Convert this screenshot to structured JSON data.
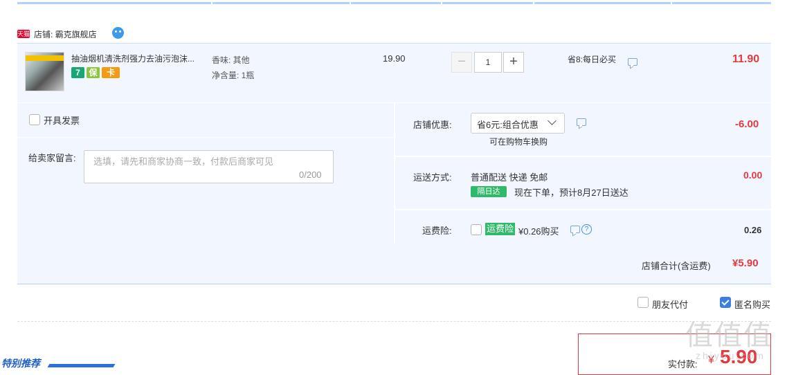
{
  "shop": {
    "badge": "天猫",
    "label": "店铺: 霸克旗舰店"
  },
  "item": {
    "title": "抽油烟机清洗剂强力去油污泡沫...",
    "attr_scent": "香味: 其他",
    "attr_volume": "净含量: 1瓶",
    "unit_price": "19.90",
    "quantity": "1",
    "qty_minus": "−",
    "qty_plus": "+",
    "promo": "省8:每日必买",
    "subtotal": "11.90",
    "service_icons": [
      "7",
      "保",
      "卡"
    ]
  },
  "invoice": {
    "label": "开具发票"
  },
  "message": {
    "label": "给卖家留言:",
    "placeholder": "选填，请先和商家协商一致，付款后商家可见",
    "count": "0/200"
  },
  "discount": {
    "label": "店铺优惠:",
    "selected": "省6元:组合优惠",
    "note": "可在购物车换购",
    "amount": "-6.00"
  },
  "shipping": {
    "label": "运送方式:",
    "method": "普通配送 快递 免邮",
    "badge": "隔日达",
    "estimate": "现在下单，预计8月27日送达",
    "amount": "0.00"
  },
  "insurance": {
    "label": "运费险:",
    "badge": "运费险",
    "price": "¥0.26购买",
    "amount": "0.26"
  },
  "total": {
    "label": "店铺合计(含运费)",
    "value": "¥5.90"
  },
  "options": {
    "friend_pay": "朋友代付",
    "anonymous": "匿名购买"
  },
  "payment": {
    "label": "实付款:",
    "currency": "¥",
    "value": "5.90"
  },
  "recommend": {
    "label": "特别推荐"
  },
  "watermark": {
    "main": "值值值",
    "sub": "zhiyou.com"
  },
  "colors": {
    "accent_red": "#e4393c",
    "panel_bg": "#f2f7ff",
    "green_badge": "#31b96a",
    "blue": "#3a7fe0"
  }
}
